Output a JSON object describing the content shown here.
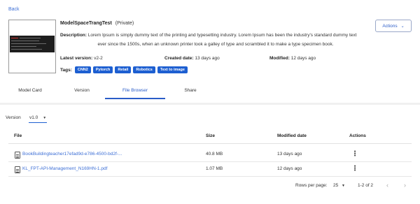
{
  "nav": {
    "back_label": "Back"
  },
  "model": {
    "name": "ModelSpaceTrangTest",
    "visibility": "(Private)",
    "description_label": "Description:",
    "description_line1": "Lorem Ipsum is simply dummy text of the printing and typesetting industry. Lorem Ipsum has been the industry's standard dummy text",
    "description_line2": "ever since the 1500s, when an unknown printer took a galley of type and scrambled it to make a type specimen book.",
    "latest_version_label": "Latest version:",
    "latest_version": "v2-2",
    "created_label": "Created date:",
    "created_value": "13 days ago",
    "modified_label": "Modified:",
    "modified_value": "12 days ago",
    "tags_label": "Tags:",
    "tags": [
      "CNN2",
      "Pytorch",
      "Retail",
      "Robotics",
      "Text to image"
    ],
    "actions_label": "Actions",
    "actions_icon": "chevron-down-icon"
  },
  "tabs": [
    {
      "label": "Model Card",
      "active": false
    },
    {
      "label": "Version",
      "active": false
    },
    {
      "label": "File Browser",
      "active": true
    },
    {
      "label": "Share",
      "active": false
    }
  ],
  "browser": {
    "version_label": "Version",
    "version_value": "v1.0",
    "columns": {
      "file": "File",
      "size": "Size",
      "modified": "Modified date",
      "actions": "Actions"
    },
    "rows": [
      {
        "name": "BookBuildingteacher17efad9d-e786-4500-bd2f-...",
        "size": "40.8 MB",
        "modified": "13 days ago"
      },
      {
        "name": "KL_FPT-API-Management_N169HN-1.pdf",
        "size": "1.07 MB",
        "modified": "12 days ago"
      }
    ],
    "pagination": {
      "rows_per_page_label": "Rows per page:",
      "rows_per_page": "25",
      "range": "1-2 of 2"
    }
  },
  "colors": {
    "accent": "#2a5cc8",
    "tag_bg": "#1d5fd1",
    "link": "#3d6fd6",
    "page_bg": "#f0f0f0"
  }
}
